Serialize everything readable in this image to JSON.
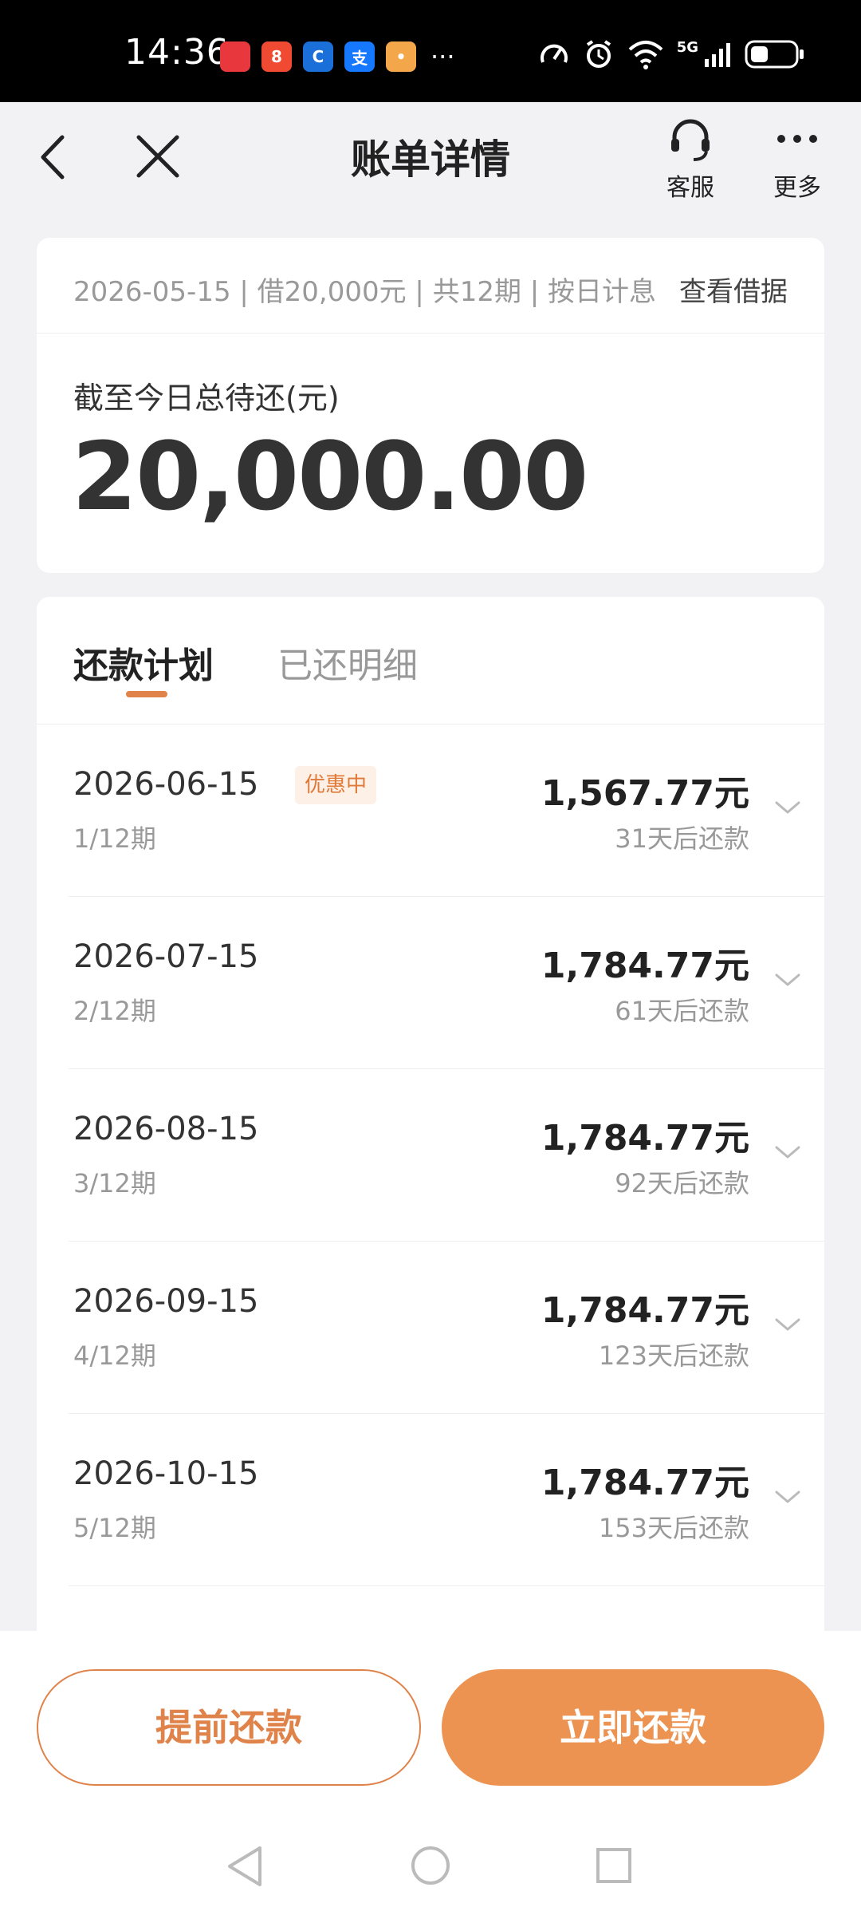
{
  "status_bar": {
    "time": "14:36",
    "apps": [
      {
        "icon": "huawei-store-icon",
        "color": "#e8383d",
        "glyph": ""
      },
      {
        "icon": "app-icon-orange",
        "color": "#f04a32",
        "glyph": "8"
      },
      {
        "icon": "bank-app-icon",
        "color": "#1b6fd8",
        "glyph": "C"
      },
      {
        "icon": "alipay-icon",
        "color": "#1677ff",
        "glyph": "支"
      },
      {
        "icon": "game-app-icon",
        "color": "#f4a64a",
        "glyph": "•"
      }
    ],
    "more": "···",
    "network": "5G",
    "battery_percent": 40
  },
  "nav": {
    "title": "账单详情",
    "service_label": "客服",
    "more_label": "更多"
  },
  "summary": {
    "info": "2026-05-15 | 借20,000元 | 共12期 | 按日计息",
    "link": "查看借据",
    "label": "截至今日总待还(元)",
    "amount": "20,000.00"
  },
  "tabs": {
    "active": "还款计划",
    "inactive": "已还明细"
  },
  "plan": [
    {
      "date": "2026-06-15",
      "badge": "优惠中",
      "period": "1/12期",
      "amount": "1,567.77元",
      "days": "31天后还款"
    },
    {
      "date": "2026-07-15",
      "badge": "",
      "period": "2/12期",
      "amount": "1,784.77元",
      "days": "61天后还款"
    },
    {
      "date": "2026-08-15",
      "badge": "",
      "period": "3/12期",
      "amount": "1,784.77元",
      "days": "92天后还款"
    },
    {
      "date": "2026-09-15",
      "badge": "",
      "period": "4/12期",
      "amount": "1,784.77元",
      "days": "123天后还款"
    },
    {
      "date": "2026-10-15",
      "badge": "",
      "period": "5/12期",
      "amount": "1,784.77元",
      "days": "153天后还款"
    }
  ],
  "actions": {
    "prepay": "提前还款",
    "pay_now": "立即还款"
  },
  "colors": {
    "accent": "#ec9352",
    "accent_dark": "#e0834a"
  }
}
